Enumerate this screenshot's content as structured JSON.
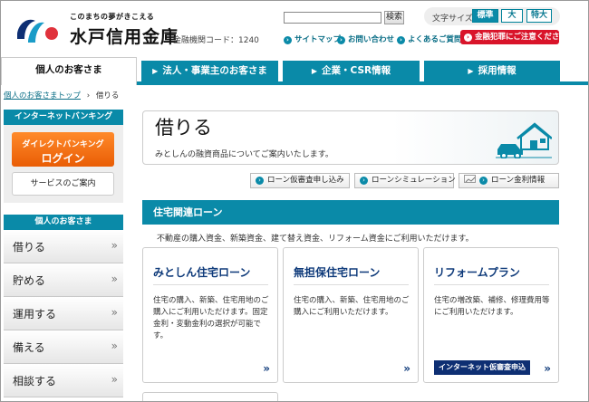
{
  "header": {
    "tagline": "このまちの夢がきこえる",
    "bank_name": "水戸信用金庫",
    "bank_code": "金融機関コード：1240",
    "search_placeholder": "",
    "search_button": "検索",
    "font_size_label": "文字サイズ",
    "font_sizes": [
      "標準",
      "大",
      "特大"
    ],
    "util_links": [
      "サイトマップ",
      "お問い合わせ",
      "よくあるご質問"
    ],
    "warning_button": "金融犯罪にご注意ください"
  },
  "nav": {
    "tabs": [
      "個人のお客さま",
      "法人・事業主のお客さま",
      "企業・CSR情報",
      "採用情報"
    ]
  },
  "breadcrumb": {
    "home": "個人のお客さまトップ",
    "separator": "›",
    "current": "借りる"
  },
  "sidebar": {
    "ib_heading": "インターネットバンキング",
    "login_line1": "ダイレクトバンキング",
    "login_line2": "ログイン",
    "service_button": "サービスのご案内",
    "menu_heading": "個人のお客さま",
    "menu_items": [
      "借りる",
      "貯める",
      "運用する",
      "備える",
      "相談する"
    ]
  },
  "main": {
    "title": "借りる",
    "subtitle": "みとしんの融資商品についてご案内いたします。",
    "sub_buttons": [
      "ローン仮審査申し込み",
      "ローンシミュレーション",
      "ローン金利情報"
    ],
    "section_title": "住宅関連ローン",
    "section_desc": "不動産の購入資金、新築資金、建て替え資金、リフォーム資金にご利用いただけます。",
    "cards": [
      {
        "title": "みとしん住宅ローン",
        "desc": "住宅の購入、新築、住宅用地のご購入にご利用いただけます。固定金利・変動金利の選択が可能です。"
      },
      {
        "title": "無担保住宅ローン",
        "desc": "住宅の購入、新築、住宅用地のご購入にご利用いただけます。"
      },
      {
        "title": "リフォームプラン",
        "desc": "住宅の増改築、補修、修理費用等にご利用いただけます。",
        "button": "インターネット仮審査申込"
      }
    ]
  },
  "colors": {
    "accent": "#0a8aa8",
    "navy": "#0e2f73",
    "warning": "#d9142a",
    "login": "#f07010"
  }
}
